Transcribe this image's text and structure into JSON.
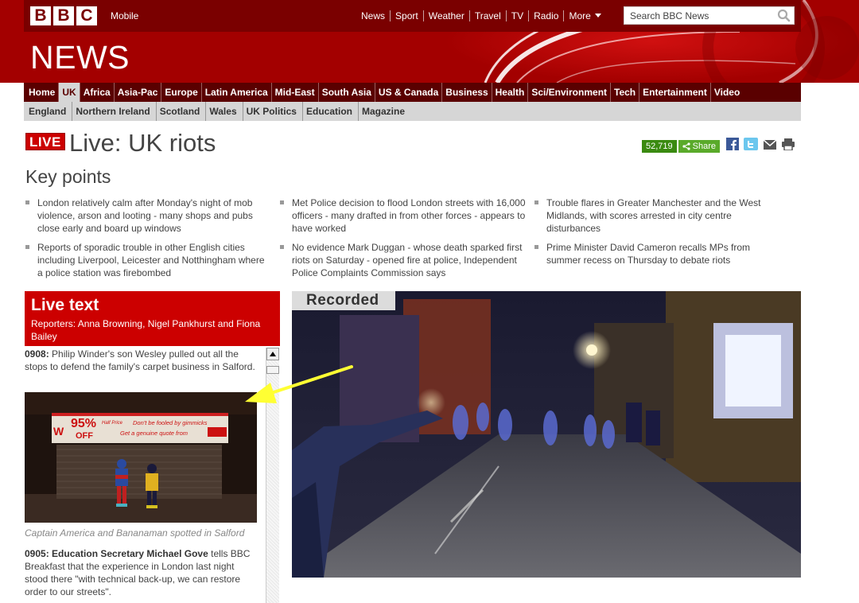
{
  "masthead": {
    "logo": [
      "B",
      "B",
      "C"
    ],
    "mobile_link": "Mobile",
    "news_title": "NEWS",
    "global_nav": [
      "News",
      "Sport",
      "Weather",
      "Travel",
      "TV",
      "Radio",
      "More"
    ],
    "search_placeholder": "Search BBC News",
    "icons": [
      "search-icon",
      "chevron-down-icon"
    ]
  },
  "main_nav": {
    "items": [
      "Home",
      "UK",
      "Africa",
      "Asia-Pac",
      "Europe",
      "Latin America",
      "Mid-East",
      "South Asia",
      "US & Canada",
      "Business",
      "Health",
      "Sci/Environment",
      "Tech",
      "Entertainment",
      "Video"
    ],
    "active": "UK"
  },
  "sub_nav": {
    "items": [
      "England",
      "Northern Ireland",
      "Scotland",
      "Wales",
      "UK Politics",
      "Education",
      "Magazine"
    ]
  },
  "story": {
    "live_badge": "LIVE",
    "title": "Live: UK riots",
    "share_count": "52,719",
    "share_label": "Share",
    "share_icons": [
      "share-icon",
      "facebook-icon",
      "twitter-icon",
      "email-icon",
      "print-icon"
    ]
  },
  "key_points": {
    "heading": "Key points",
    "items": [
      "London relatively calm after Monday's night of mob violence, arson and looting - many shops and pubs close early and board up windows",
      "Reports of sporadic trouble in other English cities including Liverpool, Leicester and Notthingham where a police station was firebombed",
      "Met Police decision to flood London streets with 16,000 officers - many drafted in from other forces - appears to have worked",
      "No evidence Mark Duggan - whose death sparked first riots on Saturday - opened fire at police, Independent Police Complaints Commission says",
      "Trouble flares in Greater Manchester and the West Midlands, with scores arrested in city centre disturbances",
      "Prime Minister David Cameron recalls MPs from summer recess on Thursday to debate riots"
    ]
  },
  "live_text": {
    "title": "Live text",
    "reporters": "Reporters: Anna Browning, Nigel Pankhurst and Fiona Bailey",
    "entry1": {
      "time": "0908:",
      "text": " Philip Winder's son Wesley pulled out all the stops to defend the family's carpet business in Salford."
    },
    "photo": {
      "sign_discount": "95%",
      "sign_off": "OFF",
      "sign_small": "Half Price",
      "sign_text1": "Don't be fooled by gimmicks",
      "sign_text2": "Get a genuine quote from"
    },
    "caption": "Captain America and Bananaman spotted in Salford",
    "entry2": {
      "time": "0905:",
      "bold": " Education Secretary Michael Gove",
      "text": " tells BBC Breakfast that the experience in London last night stood there \"with technical back-up, we can restore order to our streets\"."
    }
  },
  "video": {
    "label": "Recorded",
    "icons": [
      "video-still"
    ]
  },
  "colors": {
    "brand_red": "#cc0000",
    "masthead": "#a30000",
    "nav_dark": "#5a0000",
    "share_green": "#5aaa2a",
    "annotation_arrow": "#ffff33"
  }
}
